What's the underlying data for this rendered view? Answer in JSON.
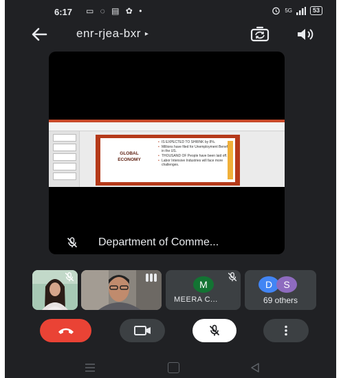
{
  "status_bar": {
    "time": "6:17",
    "notification_icons": [
      "video-icon",
      "whatsapp-icon",
      "message-icon",
      "settings-icon",
      "dot-icon"
    ],
    "notification_glyphs": "▭ ◌ ▤ ✿ •",
    "network": "5G",
    "signal_glyph": "ᵃ⁸ᴸ",
    "battery": "53"
  },
  "topbar": {
    "meeting_code": "enr-rjea-bxr",
    "caret": "▸"
  },
  "main_tile": {
    "participant_name": "Department of Comme...",
    "muted": true,
    "slide": {
      "title_line1": "GLOBAL",
      "title_line2": "ECONOMY",
      "bullets": [
        "IS EXPECTED TO SHRINK by 8%.",
        "Millions have filed for Unemployment Benefits in the US.",
        "THOUSAND OF People have been laid off.",
        "Labor Intensive Industries will face more challenges."
      ]
    }
  },
  "participants": {
    "meera": {
      "initial": "M",
      "name": "MEERA C...",
      "avatar_color": "#137333",
      "muted": true
    },
    "others": {
      "avatars": [
        {
          "initial": "D",
          "color": "#4285f4"
        },
        {
          "initial": "S",
          "color": "#8e6bbf"
        }
      ],
      "label": "69 others"
    }
  },
  "controls": {
    "end_call": "end-call",
    "video": "video-on",
    "mic": "mic-muted",
    "more": "more-options"
  },
  "colors": {
    "background": "#202124",
    "tile": "#3c4043",
    "end_call": "#ea4335",
    "text": "#e8eaed"
  }
}
